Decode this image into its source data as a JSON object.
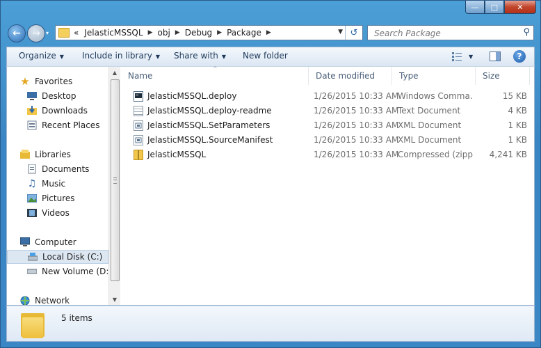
{
  "window": {
    "controls": {
      "minimize": "—",
      "maximize": "□",
      "close": "✕"
    }
  },
  "navbar": {
    "recent_glyph": "▾",
    "overflow": "«",
    "breadcrumbs": [
      "JelasticMSSQL",
      "obj",
      "Debug",
      "Package"
    ],
    "separator": "▶",
    "search_placeholder": "Search Package"
  },
  "toolbar": {
    "organize": "Organize",
    "include_in_library": "Include in library",
    "share_with": "Share with",
    "new_folder": "New folder",
    "dropdown_glyph": "▼",
    "help_label": "?"
  },
  "sidebar": {
    "favorites": {
      "label": "Favorites",
      "items": [
        "Desktop",
        "Downloads",
        "Recent Places"
      ]
    },
    "libraries": {
      "label": "Libraries",
      "items": [
        "Documents",
        "Music",
        "Pictures",
        "Videos"
      ]
    },
    "computer": {
      "label": "Computer",
      "items": [
        "Local Disk (C:)",
        "New Volume (D:)"
      ],
      "selected": "Local Disk (C:)"
    },
    "network": {
      "label": "Network"
    }
  },
  "file_list": {
    "columns": [
      "Name",
      "Date modified",
      "Type",
      "Size"
    ],
    "sort_glyph": "^",
    "files": [
      {
        "name": "JelasticMSSQL.deploy",
        "date": "1/26/2015 10:33 AM",
        "type": "Windows Comma...",
        "size": "15 KB",
        "icon": "cmd-file-icon"
      },
      {
        "name": "JelasticMSSQL.deploy-readme",
        "date": "1/26/2015 10:33 AM",
        "type": "Text Document",
        "size": "4 KB",
        "icon": "text-file-icon"
      },
      {
        "name": "JelasticMSSQL.SetParameters",
        "date": "1/26/2015 10:33 AM",
        "type": "XML Document",
        "size": "1 KB",
        "icon": "xml-file-icon"
      },
      {
        "name": "JelasticMSSQL.SourceManifest",
        "date": "1/26/2015 10:33 AM",
        "type": "XML Document",
        "size": "1 KB",
        "icon": "xml-file-icon"
      },
      {
        "name": "JelasticMSSQL",
        "date": "1/26/2015 10:33 AM",
        "type": "Compressed (zipp...",
        "size": "4,241 KB",
        "icon": "zip-folder-icon"
      }
    ]
  },
  "details": {
    "item_count": "5 items"
  },
  "colors": {
    "titlebar": "#3b87c6",
    "selection": "#dde7f2",
    "link_text": "#1e395b"
  }
}
